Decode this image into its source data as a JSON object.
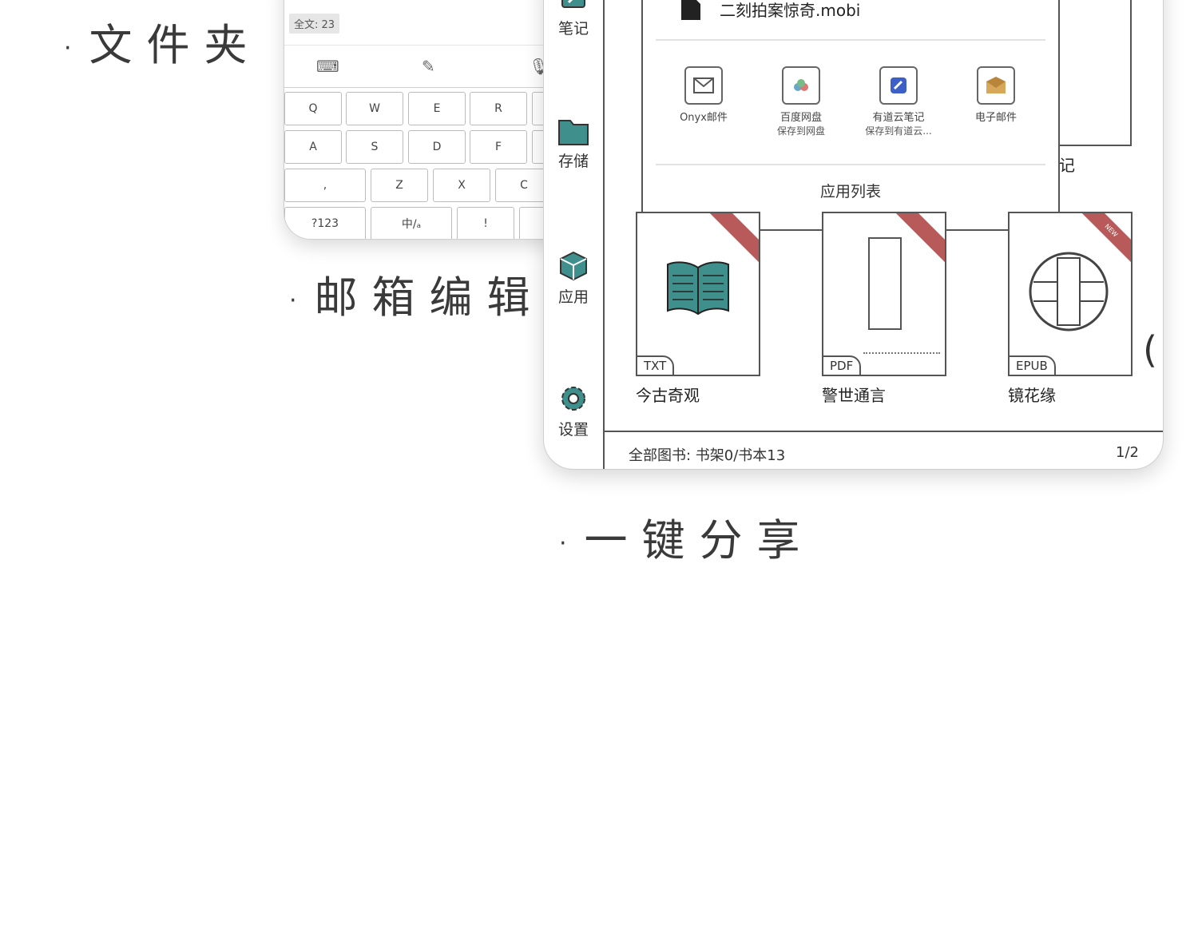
{
  "captions": {
    "folder": "文件夹",
    "email": "邮箱编辑",
    "share": "一键分享",
    "dot": "·"
  },
  "email_phone": {
    "word_count": "全文: 23",
    "toolbar": [
      "keyboard-icon",
      "pen-icon",
      "mic-icon"
    ],
    "keyboard_rows": [
      [
        "Q",
        "W",
        "E",
        "R"
      ],
      [
        "A",
        "S",
        "D",
        "F"
      ],
      [
        ",",
        "Z",
        "X",
        "C"
      ],
      [
        "?123",
        "中/ₐ",
        "!"
      ]
    ]
  },
  "tablet": {
    "sidebar": [
      {
        "label": "笔记",
        "icon": "note-icon"
      },
      {
        "label": "存储",
        "icon": "folder-icon"
      },
      {
        "label": "应用",
        "icon": "cube-icon"
      },
      {
        "label": "设置",
        "icon": "gear-icon"
      }
    ],
    "share_panel": {
      "file_name": "二刻拍案惊奇.mobi",
      "apps": [
        {
          "name": "Onyx邮件",
          "sub": "",
          "icon": "mail-icon"
        },
        {
          "name": "百度网盘",
          "sub": "保存到网盘",
          "icon": "baidu-cloud-icon"
        },
        {
          "name": "有道云笔记",
          "sub": "保存到有道云...",
          "icon": "youdao-note-icon"
        },
        {
          "name": "电子邮件",
          "sub": "",
          "icon": "email-envelope-icon"
        }
      ],
      "app_list": "应用列表"
    },
    "partial_book_text": {
      "top_right_label": "记"
    },
    "books": [
      {
        "title": "今古奇观",
        "format": "TXT"
      },
      {
        "title": "警世通言",
        "format": "PDF"
      },
      {
        "title": "镜花缘",
        "format": "EPUB",
        "ribbon": "NEW"
      }
    ],
    "footer": {
      "summary": "全部图书:  书架0/书本13",
      "page": "1/2"
    },
    "paren": "("
  },
  "colors": {
    "teal": "#3f8f8c",
    "ribbon": "#b85a5a",
    "border": "#555555"
  }
}
